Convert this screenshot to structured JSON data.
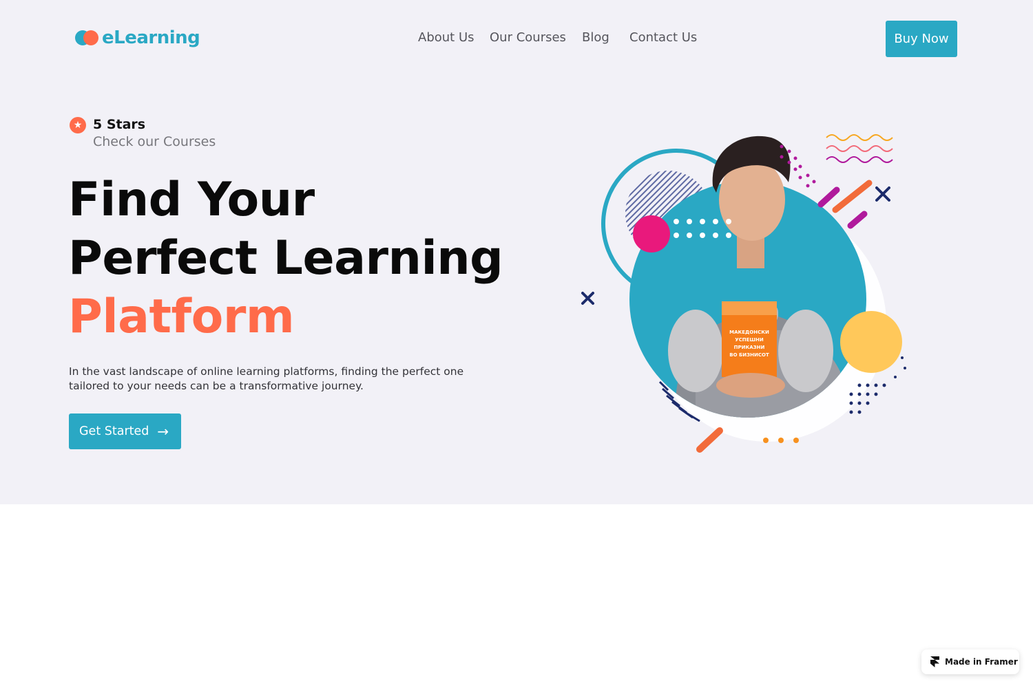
{
  "brand": {
    "name": "eLearning"
  },
  "nav": {
    "items": [
      {
        "label": "About Us"
      },
      {
        "label": "Our Courses"
      },
      {
        "label": "Blog"
      },
      {
        "label": "Contact Us"
      }
    ],
    "buy_label": "Buy Now"
  },
  "rating": {
    "title": "5 Stars",
    "subtitle": "Check our Courses",
    "icon": "star-icon"
  },
  "hero": {
    "line1": "Find Your",
    "line2": "Perfect Learning",
    "line3": "Platform",
    "description": "In the vast landscape of online learning platforms, finding the perfect one tailored to your needs can be a transformative journey.",
    "cta_label": "Get Started",
    "cta_icon": "arrow-right-icon"
  },
  "book": {
    "title": "МАКЕДОНСКИ УСПЕШНИ ПРИКАЗНИ ВО БИЗНИСОТ"
  },
  "badge": {
    "label": "Made in Framer",
    "icon": "framer-icon"
  },
  "colors": {
    "accent": "#2aa8c4",
    "highlight": "#ff6b4a",
    "hero_bg": "#f2f1f7"
  }
}
